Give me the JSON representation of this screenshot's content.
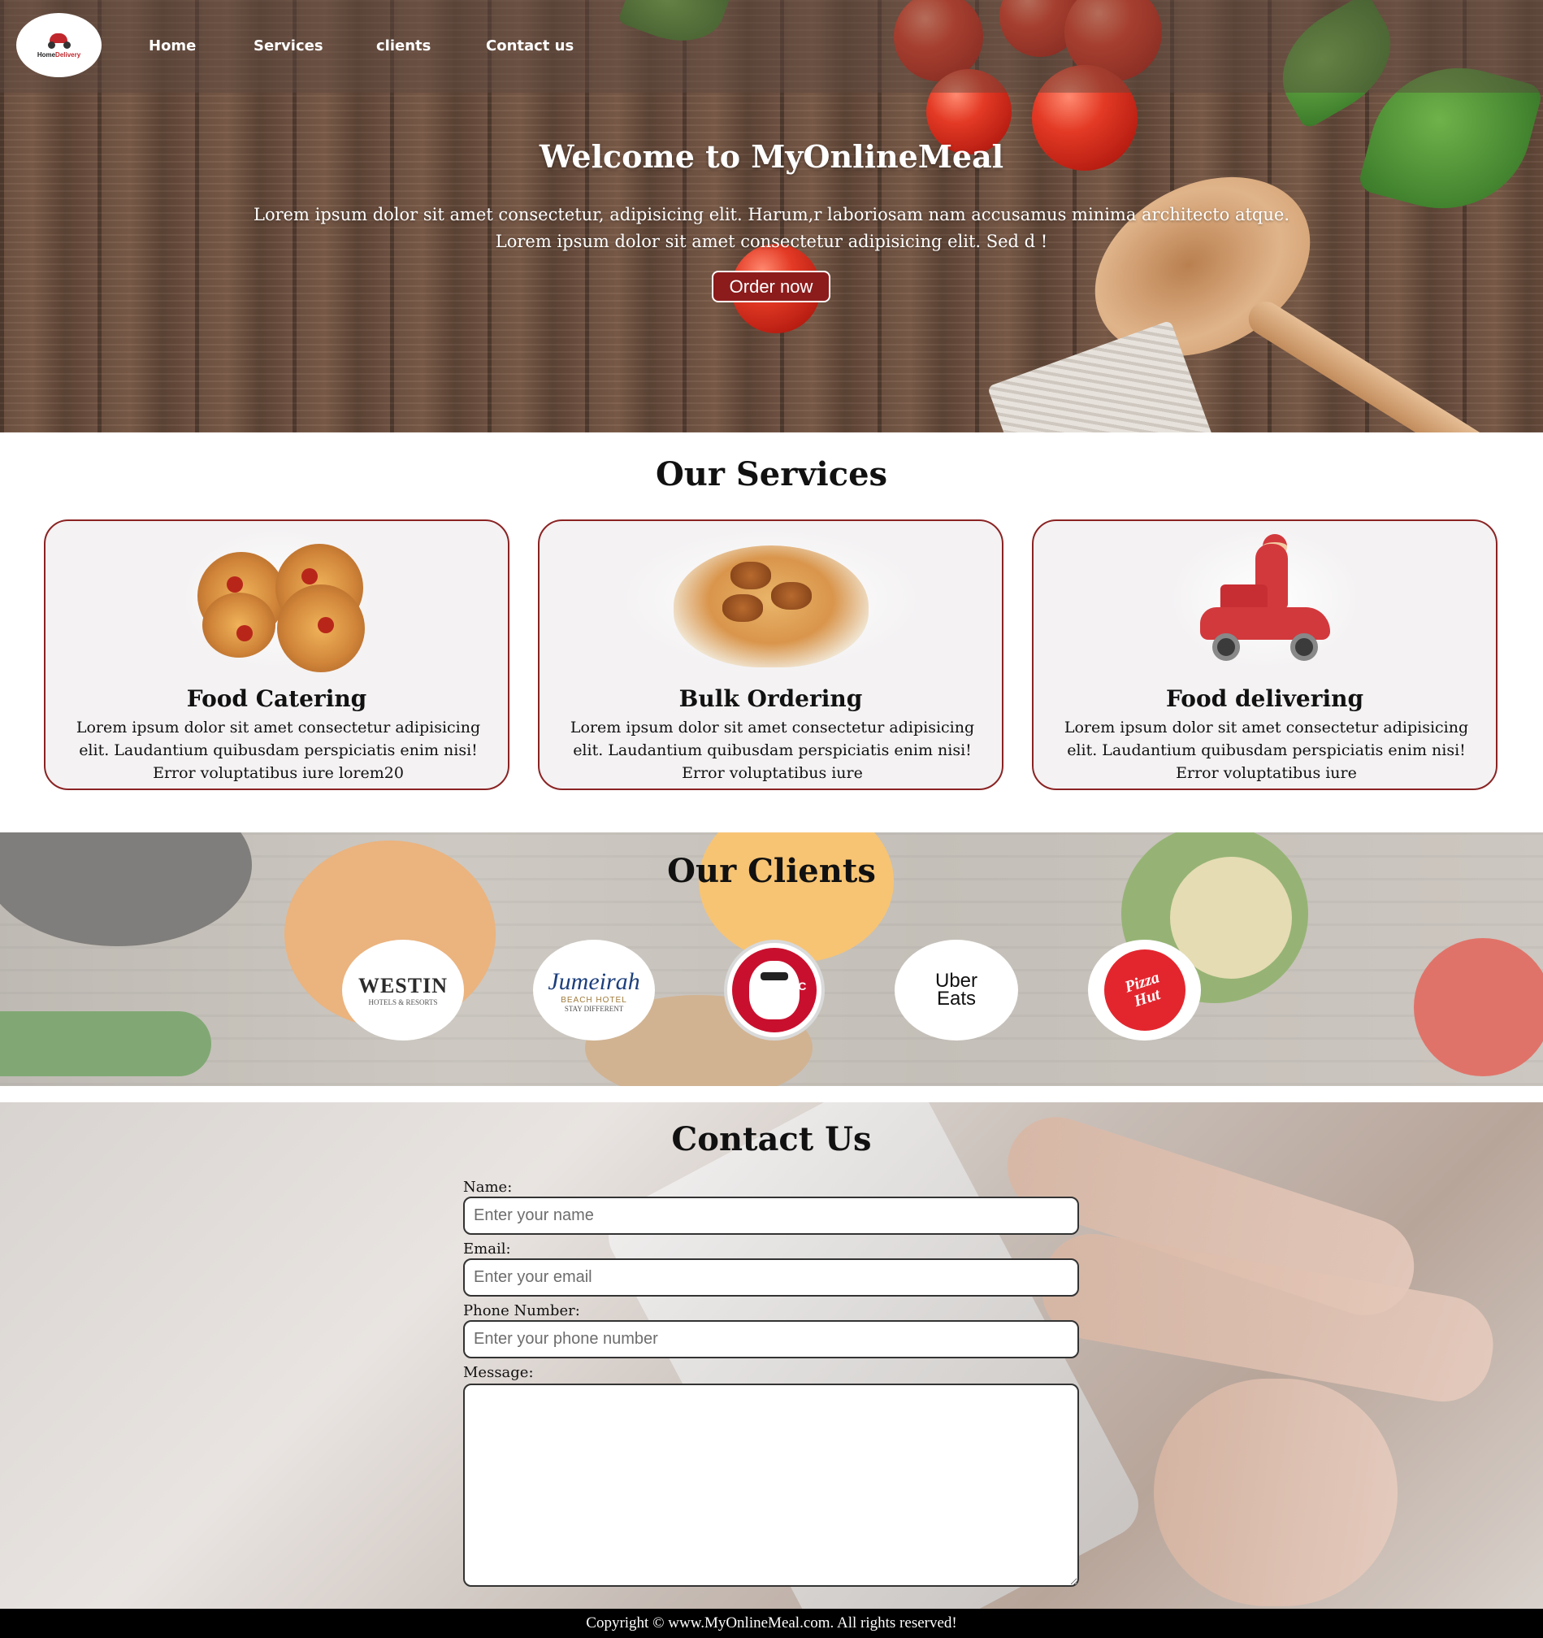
{
  "nav": {
    "logo_text_a": "Home",
    "logo_text_b": "Delivery",
    "links": [
      "Home",
      "Services",
      "clients",
      "Contact us"
    ]
  },
  "hero": {
    "title": "Welcome to MyOnlineMeal",
    "text_line1": "Lorem ipsum dolor sit amet consectetur, adipisicing elit. Harum,r laboriosam nam accusamus minima architecto atque.",
    "text_line2": "Lorem ipsum dolor sit amet consectetur adipisicing elit. Sed d !",
    "button_label": "Order now"
  },
  "services": {
    "title": "Our Services",
    "cards": [
      {
        "icon": "pizza-icon",
        "title": "Food Catering",
        "text": "Lorem ipsum dolor sit amet consectetur adipisicing elit. Laudantium quibusdam perspiciatis enim nisi! Error voluptatibus iure lorem20"
      },
      {
        "icon": "biryani-icon",
        "title": "Bulk Ordering",
        "text": "Lorem ipsum dolor sit amet consectetur adipisicing elit. Laudantium quibusdam perspiciatis enim nisi! Error voluptatibus iure"
      },
      {
        "icon": "delivery-scooter-icon",
        "title": "Food delivering",
        "text": "Lorem ipsum dolor sit amet consectetur adipisicing elit. Laudantium quibusdam perspiciatis enim nisi! Error voluptatibus iure"
      }
    ]
  },
  "clients": {
    "title": "Our Clients",
    "logos": {
      "westin": {
        "name": "WESTIN",
        "sub": "HOTELS & RESORTS"
      },
      "jumeirah": {
        "name": "Jumeirah",
        "sub": "BEACH HOTEL",
        "tag": "STAY DIFFERENT"
      },
      "kfc": {
        "name": "KFC"
      },
      "uber": {
        "line1": "Uber",
        "line2": "Eats"
      },
      "pizzahut": {
        "line1": "Pizza",
        "line2": "Hut"
      }
    }
  },
  "contact": {
    "title": "Contact Us",
    "name_label": "Name:",
    "name_placeholder": "Enter your name",
    "email_label": "Email:",
    "email_placeholder": "Enter your email",
    "phone_label": "Phone Number:",
    "phone_placeholder": "Enter your phone number",
    "message_label": "Message:"
  },
  "footer": {
    "text": "Copyright © www.MyOnlineMeal.com. All rights reserved!"
  },
  "colors": {
    "accent": "#8b2323",
    "button_bg": "#8c1c1c",
    "footer_bg": "#000000"
  }
}
